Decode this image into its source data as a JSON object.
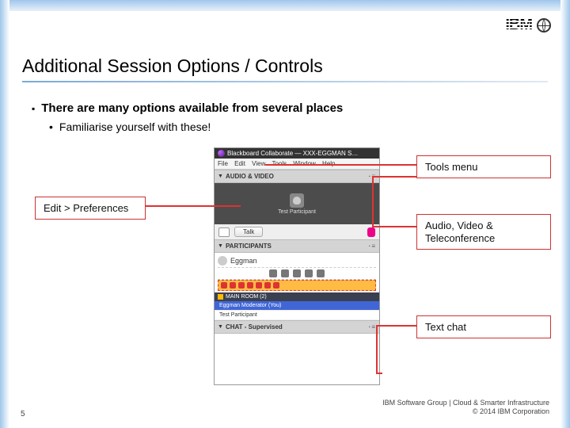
{
  "logo_text": "IBM",
  "title": "Additional Session Options / Controls",
  "bullet_main": "There are many options available from several places",
  "bullet_sub": "Familiarise yourself with these!",
  "app": {
    "window_title": "Blackboard Collaborate — XXX-EGGMAN S…",
    "menu": {
      "file": "File",
      "edit": "Edit",
      "view": "View",
      "tools": "Tools",
      "window": "Window",
      "help": "Help"
    },
    "panel_audio": "AUDIO & VIDEO",
    "video_user": "Test Participant",
    "talk_label": "Talk",
    "panel_participants": "PARTICIPANTS",
    "participant_name": "Eggman",
    "main_room": "MAIN ROOM (2)",
    "mod_row": "Eggman   Moderator (You)",
    "part_row": "Test Participant",
    "panel_chat": "CHAT - Supervised",
    "panel_menu_glyph": "·≡"
  },
  "callouts": {
    "tools": "Tools menu",
    "edit": "Edit > Preferences",
    "av": "Audio, Video & Teleconference",
    "chat": "Text chat"
  },
  "footer": {
    "page": "5",
    "group": "IBM Software Group | Cloud & Smarter Infrastructure",
    "copyright": "© 2014 IBM Corporation"
  }
}
